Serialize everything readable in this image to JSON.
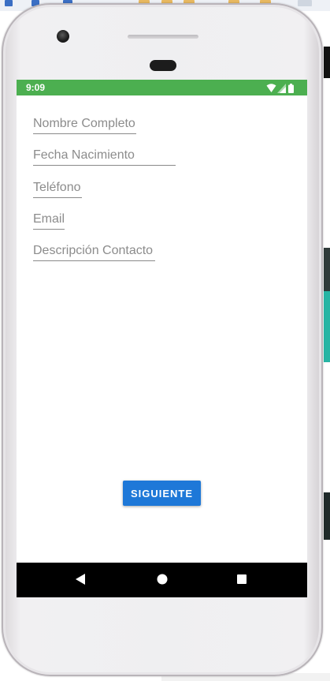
{
  "status_bar": {
    "time": "9:09",
    "color": "#4caf50",
    "icons": [
      "wifi-icon",
      "signal-icon",
      "battery-icon"
    ]
  },
  "form": {
    "fields": [
      {
        "placeholder": "Nombre Completo"
      },
      {
        "placeholder": "Fecha Nacimiento"
      },
      {
        "placeholder": "Teléfono"
      },
      {
        "placeholder": "Email"
      },
      {
        "placeholder": "Descripción Contacto"
      }
    ],
    "submit_label": "SIGUIENTE",
    "submit_color": "#1e78d8"
  },
  "nav_bar": {
    "buttons": [
      "back-icon",
      "home-icon",
      "recents-icon"
    ]
  }
}
